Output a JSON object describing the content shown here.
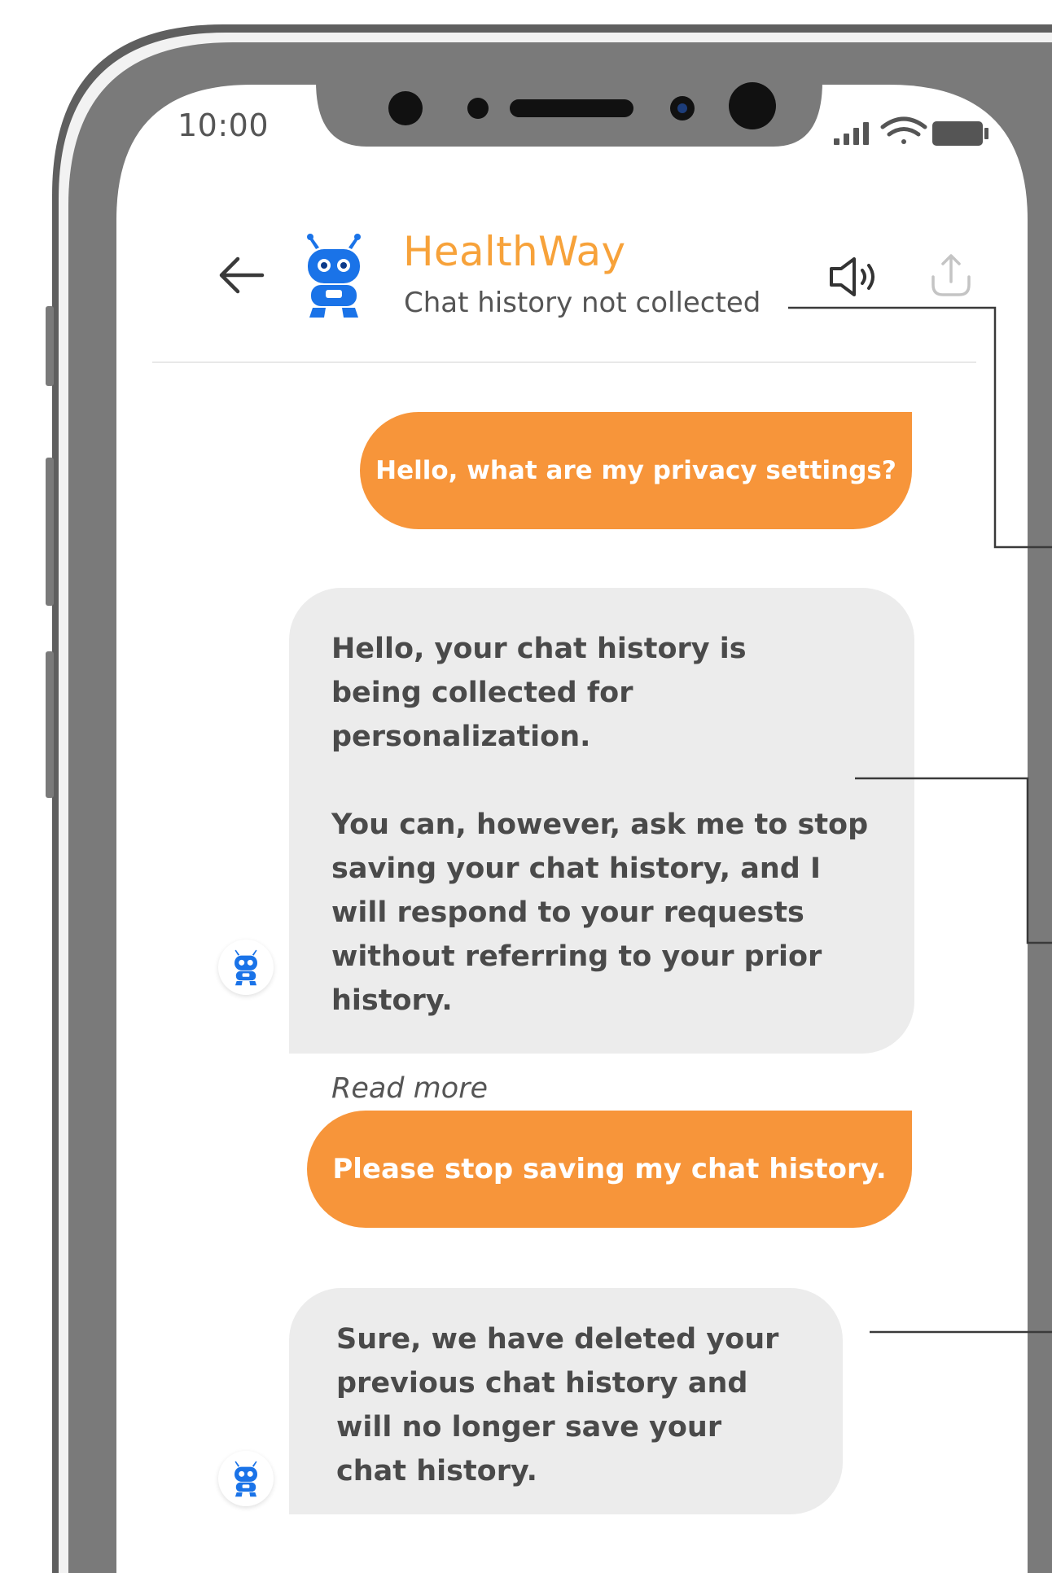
{
  "status_bar": {
    "time": "10:00"
  },
  "header": {
    "title": "HealthWay",
    "subtitle": "Chat history not collected",
    "icons": {
      "back": "arrow-left-icon",
      "avatar": "robot-icon",
      "speaker": "speaker-icon",
      "share": "share-icon"
    }
  },
  "messages": [
    {
      "sender": "user",
      "text": "Hello, what are my privacy settings?"
    },
    {
      "sender": "bot",
      "paragraphs": [
        "Hello, your chat history is being collected for personalization.",
        "You can, however, ask me to stop saving your chat history, and I will respond to your requests without referring to your prior history."
      ],
      "read_more": "Read more"
    },
    {
      "sender": "user",
      "text": "Please stop saving my chat history."
    },
    {
      "sender": "bot",
      "text": "Sure, we have deleted your previous chat history and will no longer save your chat history."
    }
  ],
  "colors": {
    "accent": "#f7953a",
    "title": "#f7a23a",
    "bot_bubble": "#ececec",
    "robot": "#1a73e8",
    "phone_frame": "#7a7a7a"
  }
}
